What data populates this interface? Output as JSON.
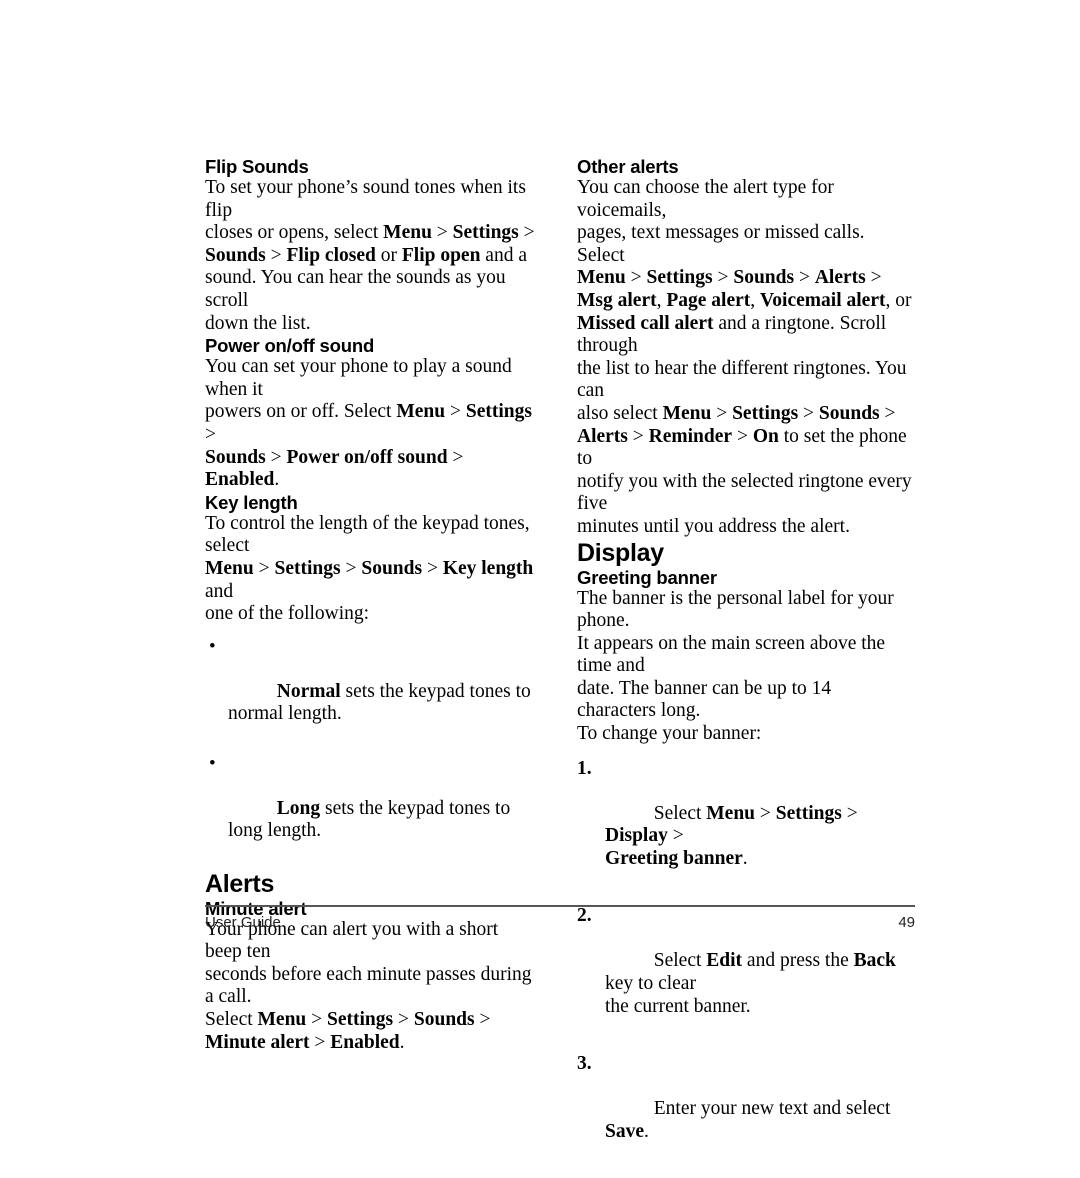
{
  "document": {
    "type": "user-manual-page",
    "page_number": "49",
    "footer_label": "User Guide"
  },
  "left_column": {
    "flip_sounds": {
      "heading": "Flip Sounds",
      "paragraph_html": "To set your phone’s sound tones when its flip\ncloses or opens, select <b>Menu</b> &gt; <b>Settings</b> &gt;\n<b>Sounds</b> &gt; <b>Flip closed</b> or <b>Flip open</b> and a\nsound. You can hear the sounds as you scroll\ndown the list.",
      "paragraph_text": "To set your phone’s sound tones when its flip closes or opens, select Menu > Settings > Sounds > Flip closed or Flip open and a sound. You can hear the sounds as you scroll down the list."
    },
    "power_onoff_sound": {
      "heading": "Power on/off sound",
      "paragraph_html": "You can set your phone to play a sound when it\npowers on or off. Select <b>Menu</b> &gt; <b>Settings</b> &gt;\n<b>Sounds</b> &gt; <b>Power on/off sound</b> &gt; <b>Enabled</b>.",
      "paragraph_text": "You can set your phone to play a sound when it powers on or off. Select Menu > Settings > Sounds > Power on/off sound > Enabled."
    },
    "key_length": {
      "heading": "Key length",
      "paragraph_html": "To control the length of the keypad tones, select\n<b>Menu</b> &gt; <b>Settings</b> &gt; <b>Sounds</b> &gt; <b>Key length</b> and\none of the following:",
      "paragraph_text": "To control the length of the keypad tones, select Menu > Settings > Sounds > Key length and one of the following:",
      "bullets": [
        {
          "marker": "•",
          "html": "<b>Normal</b> sets the keypad tones to\nnormal length.",
          "text": "Normal sets the keypad tones to normal length."
        },
        {
          "marker": "•",
          "html": "<b>Long</b> sets the keypad tones to long length.",
          "text": "Long sets the keypad tones to long length."
        }
      ]
    },
    "alerts_section": {
      "heading": "Alerts"
    },
    "minute_alert": {
      "heading": "Minute alert",
      "paragraph_html": "Your phone can alert you with a short beep ten\nseconds before each minute passes during a call.\nSelect <b>Menu</b> &gt; <b>Settings</b> &gt; <b>Sounds</b> &gt;\n<b>Minute alert</b> &gt; <b>Enabled</b>.",
      "paragraph_text": "Your phone can alert you with a short beep ten seconds before each minute passes during a call. Select Menu > Settings > Sounds > Minute alert > Enabled."
    }
  },
  "right_column": {
    "other_alerts": {
      "heading": "Other alerts",
      "paragraph_html": "You can choose the alert type for voicemails,\npages, text messages or missed calls. Select\n<b>Menu</b> &gt; <b>Settings</b> &gt; <b>Sounds</b> &gt; <b>Alerts</b> &gt;\n<b>Msg alert</b>, <b>Page alert</b>, <b>Voicemail alert</b>, or\n<b>Missed call alert</b> and a ringtone. Scroll through\nthe list to hear the different ringtones. You can\nalso select <b>Menu</b> &gt; <b>Settings</b> &gt; <b>Sounds</b> &gt;\n<b>Alerts</b> &gt; <b>Reminder</b> &gt; <b>On</b> to set the phone to\nnotify you with the selected ringtone every five\nminutes until you address the alert.",
      "paragraph_text": "You can choose the alert type for voicemails, pages, text messages or missed calls. Select Menu > Settings > Sounds > Alerts > Msg alert, Page alert, Voicemail alert, or Missed call alert and a ringtone. Scroll through the list to hear the different ringtones. You can also select Menu > Settings > Sounds > Alerts > Reminder > On to set the phone to notify you with the selected ringtone every five minutes until you address the alert."
    },
    "display_section": {
      "heading": "Display"
    },
    "greeting_banner": {
      "heading": "Greeting banner",
      "paragraph_html": "The banner is the personal label for your phone.\nIt appears on the main screen above the time and\ndate. The banner can be up to 14 characters long.\nTo change your banner:",
      "paragraph_text": "The banner is the personal label for your phone. It appears on the main screen above the time and date. The banner can be up to 14 characters long. To change your banner:",
      "steps": [
        {
          "number": "1.",
          "html": "Select <b>Menu</b> &gt; <b>Settings</b> &gt; <b>Display</b> &gt;\n<b>Greeting banner</b>.",
          "text": "Select Menu > Settings > Display > Greeting banner."
        },
        {
          "number": "2.",
          "html": "Select <b>Edit</b> and press the <b>Back</b> key to clear\nthe current banner.",
          "text": "Select Edit and press the Back key to clear the current banner."
        },
        {
          "number": "3.",
          "html": "Enter your new text and select <b>Save</b>.",
          "text": "Enter your new text and select Save."
        }
      ]
    }
  },
  "colors": {
    "text": "#000000",
    "background": "#ffffff",
    "rule": "#555555"
  }
}
